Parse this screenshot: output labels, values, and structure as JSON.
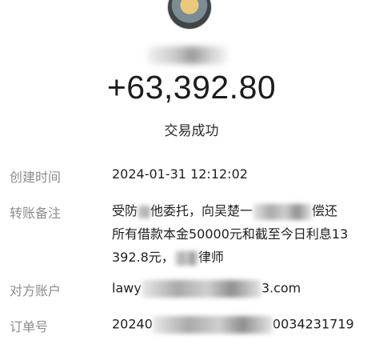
{
  "header": {
    "avatar_icon": "user-avatar-photo",
    "amount": "+63,392.80",
    "status": "交易成功"
  },
  "details": {
    "created_time": {
      "label": "创建时间",
      "value": "2024-01-31 12:12:02"
    },
    "memo": {
      "label": "转账备注",
      "line1_a": "受防",
      "line1_b": "他委托，向吴楚一",
      "line1_c": "偿还",
      "line2": "所有借款本金50000元和截至今日利息13",
      "line3_a": "392.8元，",
      "line3_b": "律师"
    },
    "counterparty": {
      "label": "对方账户",
      "value_prefix": "lawy",
      "value_suffix": "3.com"
    },
    "order": {
      "label": "订单号",
      "value_prefix": "20240",
      "value_suffix": "0034231719"
    }
  }
}
